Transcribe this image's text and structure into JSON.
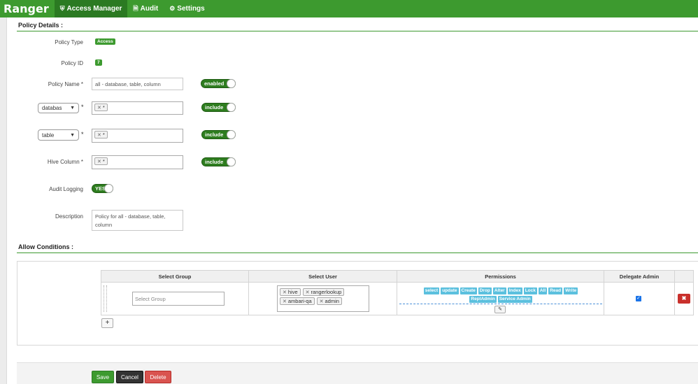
{
  "app": {
    "brand": "Ranger"
  },
  "nav": [
    {
      "label": "Access Manager",
      "icon": "shield-icon",
      "active": true
    },
    {
      "label": "Audit",
      "icon": "file-icon",
      "active": false
    },
    {
      "label": "Settings",
      "icon": "gear-icon",
      "active": false
    }
  ],
  "policy_details": {
    "title": "Policy Details :",
    "policy_type_label": "Policy Type",
    "policy_type_value": "Access",
    "policy_id_label": "Policy ID",
    "policy_id_value": "7",
    "policy_name_label": "Policy Name *",
    "policy_name_value": "all - database, table, column",
    "enabled_toggle": "enabled",
    "resource1_select": "databas",
    "resource1_tag": "*",
    "resource1_toggle": "include",
    "resource2_select": "table",
    "resource2_tag": "*",
    "resource2_toggle": "include",
    "hive_column_label": "Hive Column *",
    "hive_column_tag": "*",
    "hive_column_toggle": "include",
    "audit_logging_label": "Audit Logging",
    "audit_logging_toggle": "YES",
    "description_label": "Description",
    "description_value": "Policy for all - database, table, column",
    "required_star": "*"
  },
  "allow_conditions": {
    "title": "Allow Conditions :",
    "headers": {
      "group": "Select Group",
      "user": "Select User",
      "permissions": "Permissions",
      "delegate": "Delegate Admin"
    },
    "group_placeholder": "Select Group",
    "users": [
      "hive",
      "rangerlookup",
      "ambari-qa",
      "admin"
    ],
    "permissions": [
      "select",
      "update",
      "Create",
      "Drop",
      "Alter",
      "Index",
      "Lock",
      "All",
      "Read",
      "Write",
      "ReplAdmin",
      "Service Admin"
    ],
    "delegate_admin_checked": true
  },
  "footer": {
    "save": "Save",
    "cancel": "Cancel",
    "delete": "Delete"
  },
  "colors": {
    "brand_green": "#3d9a2f",
    "toggle_green": "#2e7d1f",
    "perm_blue": "#5bc0de",
    "danger": "#d9534f"
  }
}
